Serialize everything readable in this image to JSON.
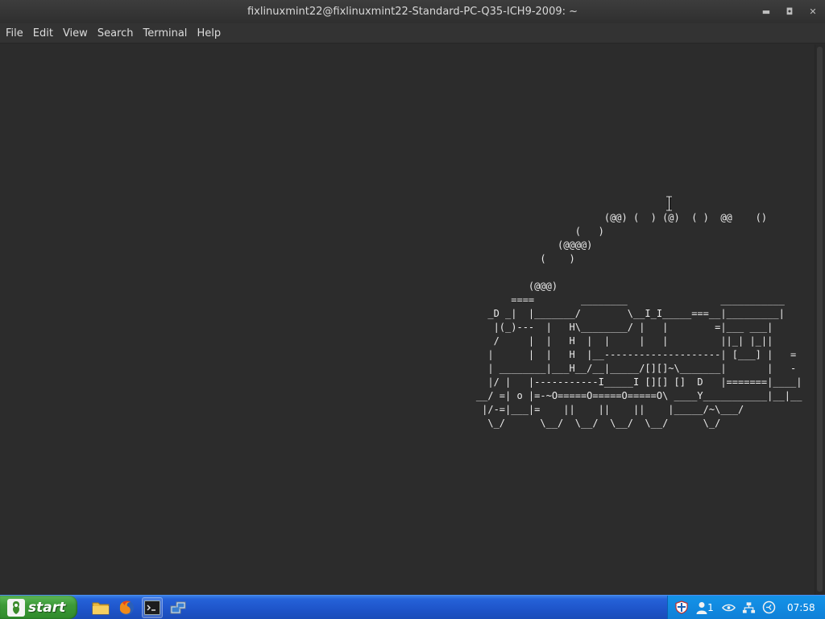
{
  "window": {
    "title": "fixlinuxmint22@fixlinuxmint22-Standard-PC-Q35-ICH9-2009: ~"
  },
  "menu": {
    "items": [
      "File",
      "Edit",
      "View",
      "Search",
      "Terminal",
      "Help"
    ]
  },
  "terminal": {
    "content": "                          (@@) (  ) (@)  ( )  @@    ()\n                     (   )\n                  (@@@@)\n               (    )\n\n             (@@@)\n          ====        ________                ___________\n      _D _|  |_______/        \\__I_I_____===__|_________|\n       |(_)---  |   H\\________/ |   |        =|___ ___|\n       /     |  |   H  |  |     |   |         ||_| |_||\n      |      |  |   H  |__--------------------| [___] |   =\n      | ________|___H__/__|_____/[][]~\\_______|       |   -\n      |/ |   |-----------I_____I [][] []  D   |=======|____|\n    __/ =| o |=-~O=====O=====O=====O\\ ____Y___________|__|__\n     |/-=|___|=    ||    ||    ||    |_____/~\\___/\n      \\_/      \\__/  \\__/  \\__/  \\__/      \\_/"
  },
  "taskbar": {
    "start_label": "start",
    "quick_launch": [
      "file-manager-icon",
      "firefox-icon",
      "terminal-icon",
      "network-places-icon"
    ],
    "tray": {
      "badge_count": "1",
      "clock": "07:58"
    }
  }
}
